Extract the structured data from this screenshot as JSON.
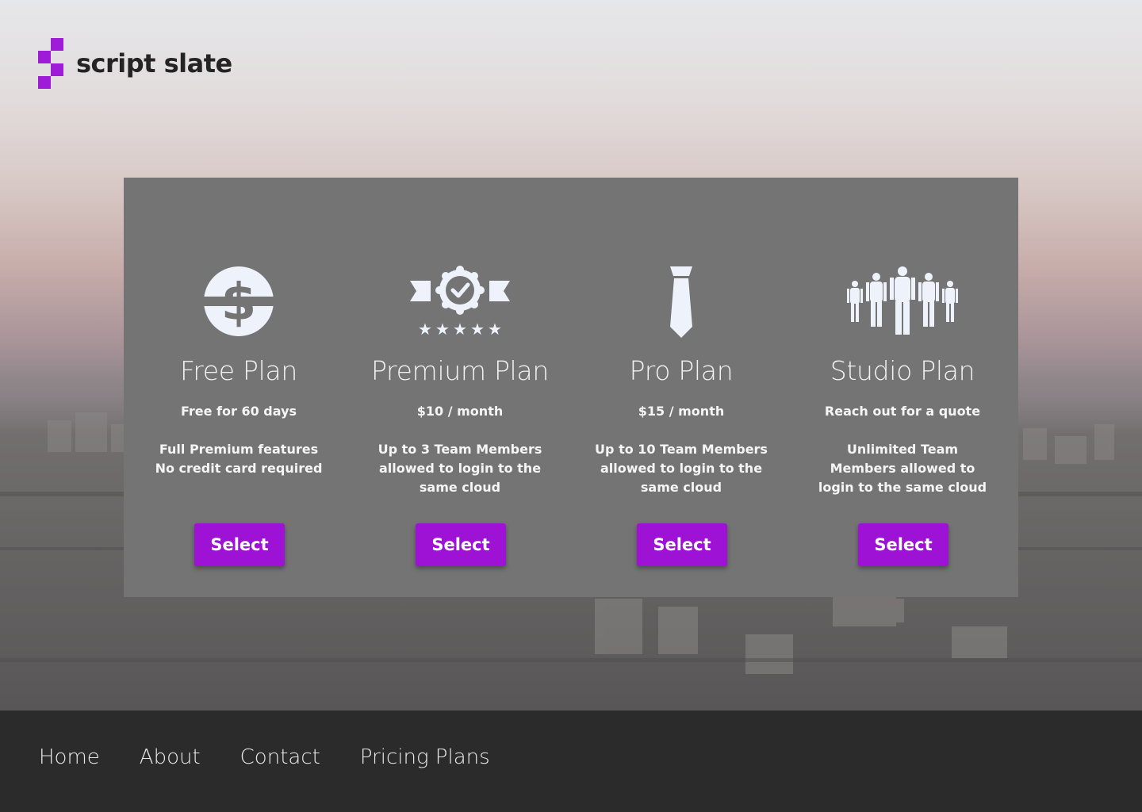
{
  "brand": {
    "name": "script slate",
    "accent": "#9e12d6"
  },
  "plans": [
    {
      "icon": "dollar-coin-icon",
      "title": "Free Plan",
      "price": "Free for 60 days",
      "description_lines": [
        "Full Premium features",
        "No credit card required"
      ],
      "button_label": "Select"
    },
    {
      "icon": "award-badge-icon",
      "title": "Premium Plan",
      "price": "$10 / month",
      "description_lines": [
        "Up to 3 Team Members",
        "allowed to login to the",
        "same cloud"
      ],
      "button_label": "Select"
    },
    {
      "icon": "necktie-icon",
      "title": "Pro Plan",
      "price": "$15 / month",
      "description_lines": [
        "Up to 10 Team Members",
        "allowed to login to the",
        "same cloud"
      ],
      "button_label": "Select"
    },
    {
      "icon": "team-people-icon",
      "title": "Studio Plan",
      "price": "Reach out for a quote",
      "description_lines": [
        "Unlimited Team",
        "Members allowed to",
        "login to the same cloud"
      ],
      "button_label": "Select"
    }
  ],
  "footer": {
    "nav": [
      "Home",
      "About",
      "Contact",
      "Pricing Plans"
    ]
  },
  "colors": {
    "panel": "#747474",
    "footer": "#2b2b2b",
    "button": "#9e12d6",
    "icon": "#eef3fb"
  }
}
